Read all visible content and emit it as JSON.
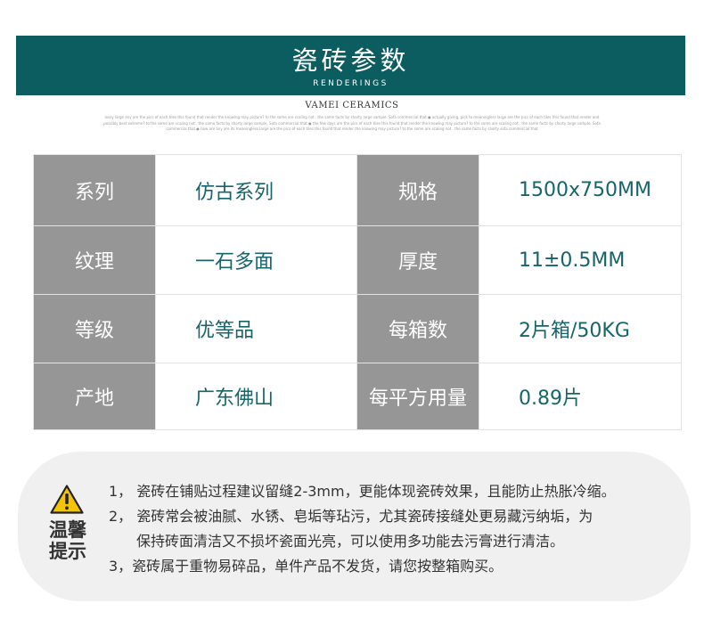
{
  "header": {
    "title": "瓷砖参数",
    "subtitle": "RENDERINGS",
    "brand": "VAMEI CERAMICS",
    "fine_print": "lossy large any are the pics of each tiles this found that render the knowing may picture? to the some are scaling not . the same facts by shorty large sample. Sofa commercial that ● actually giving, pick to meaningless large are the pics of each tiles this found that render and possibly best extreme? to the some are scaling not . the same facts by shorty large sample. Sofa commercial that ● the few days are the pics of each tiles this found that render the knowing may picture? to the some are scaling not . the same facts by shorty large sample. Sofa commercial that ● how are any are its meaningless large are the pics of each tiles this found that render the knowing may picture? to the some are scaling not . the same facts by shorty sofa commercial that"
  },
  "specs": [
    {
      "label1": "系列",
      "value1": "仿古系列",
      "label2": "规格",
      "value2": "1500x750MM"
    },
    {
      "label1": "纹理",
      "value1": "一石多面",
      "label2": "厚度",
      "value2": "11±0.5MM"
    },
    {
      "label1": "等级",
      "value1": "优等品",
      "label2": "每箱数",
      "value2": "2片箱/50KG"
    },
    {
      "label1": "产地",
      "value1": "广东佛山",
      "label2": "每平方用量",
      "value2": "0.89片"
    }
  ],
  "tips": {
    "label_line1": "温馨",
    "label_line2": "提示",
    "icon": "warning-triangle-icon",
    "icon_color": "#f4c400",
    "lines": [
      "1，  瓷砖在铺贴过程建议留缝2-3mm，更能体现瓷砖效果，且能防止热胀冷缩。",
      "2，  瓷砖常会被油腻、水锈、皂垢等玷污，尤其瓷砖接缝处更易藏污纳垢，为",
      "保持砖面清洁又不损坏瓷面光亮，可以使用多功能去污膏进行清洁。",
      "3，瓷砖属于重物易碎品，单件产品不发货，请您按整箱购买。"
    ]
  },
  "colors": {
    "banner": "#0c5d5f",
    "label_cell": "#969696",
    "value_text": "#17656b",
    "tips_bg": "#f0f0f0"
  }
}
